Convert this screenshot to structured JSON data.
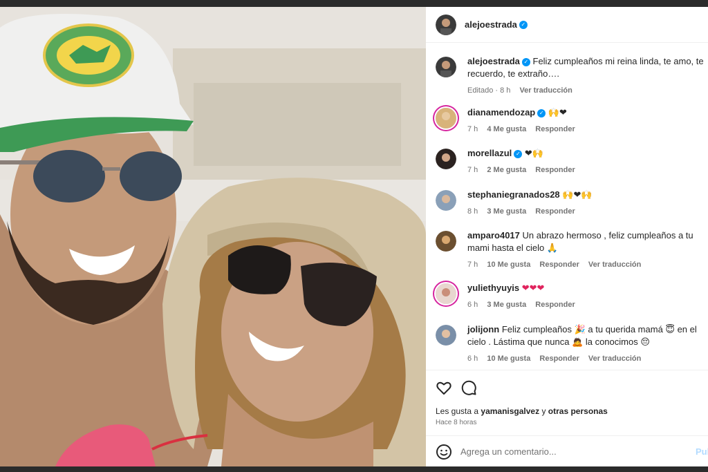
{
  "post": {
    "author": "alejoestrada",
    "caption_user": "alejoestrada",
    "caption_text": "Feliz cumpleaños mi reina linda, te amo, te recuerdo, te extraño….",
    "caption_edited": "Editado · 8 h",
    "caption_translate": "Ver traducción"
  },
  "comments": [
    {
      "user": "dianamendozap",
      "verified": true,
      "text": "🙌❤",
      "time": "7 h",
      "likes": "4 Me gusta",
      "reply": "Responder",
      "translate": "",
      "ring": true
    },
    {
      "user": "morellazul",
      "verified": true,
      "text": "❤🙌",
      "time": "7 h",
      "likes": "2 Me gusta",
      "reply": "Responder",
      "translate": "",
      "ring": false
    },
    {
      "user": "stephaniegranados28",
      "verified": false,
      "text": "🙌❤🙌",
      "time": "8 h",
      "likes": "3 Me gusta",
      "reply": "Responder",
      "translate": "",
      "ring": false
    },
    {
      "user": "amparo4017",
      "verified": false,
      "text": "Un abrazo hermoso , feliz cumpleaños a tu mami hasta el cielo 🙏",
      "time": "7 h",
      "likes": "10 Me gusta",
      "reply": "Responder",
      "translate": "Ver traducción",
      "ring": false
    },
    {
      "user": "yuliethyuyis",
      "verified": false,
      "text": "❤❤❤",
      "time": "6 h",
      "likes": "3 Me gusta",
      "reply": "Responder",
      "translate": "",
      "ring": true
    },
    {
      "user": "jolijonn",
      "verified": false,
      "text": "Feliz cumpleaños 🎉 a tu querida mamá 😇 en el cielo . Lástima que nunca 🙇 la conocimos 😔",
      "time": "6 h",
      "likes": "10 Me gusta",
      "reply": "Responder",
      "translate": "Ver traducción",
      "ring": false
    }
  ],
  "likes": {
    "prefix": "Les gusta a",
    "user": "yamanisgalvez",
    "joiner": "y",
    "others": "otras personas"
  },
  "posted_ago": "Hace 8 horas",
  "add_comment": {
    "placeholder": "Agrega un comentario...",
    "post_label": "Publicar"
  },
  "icons": {
    "like": "heart-outline-icon",
    "comment": "comment-bubble-icon",
    "emoji": "emoji-smile-icon",
    "verified": "verified-badge-icon"
  },
  "colors": {
    "accent": "#0095f6",
    "heart": "#e0245e",
    "muted": "#737373",
    "post_disabled": "#b3dbff"
  }
}
